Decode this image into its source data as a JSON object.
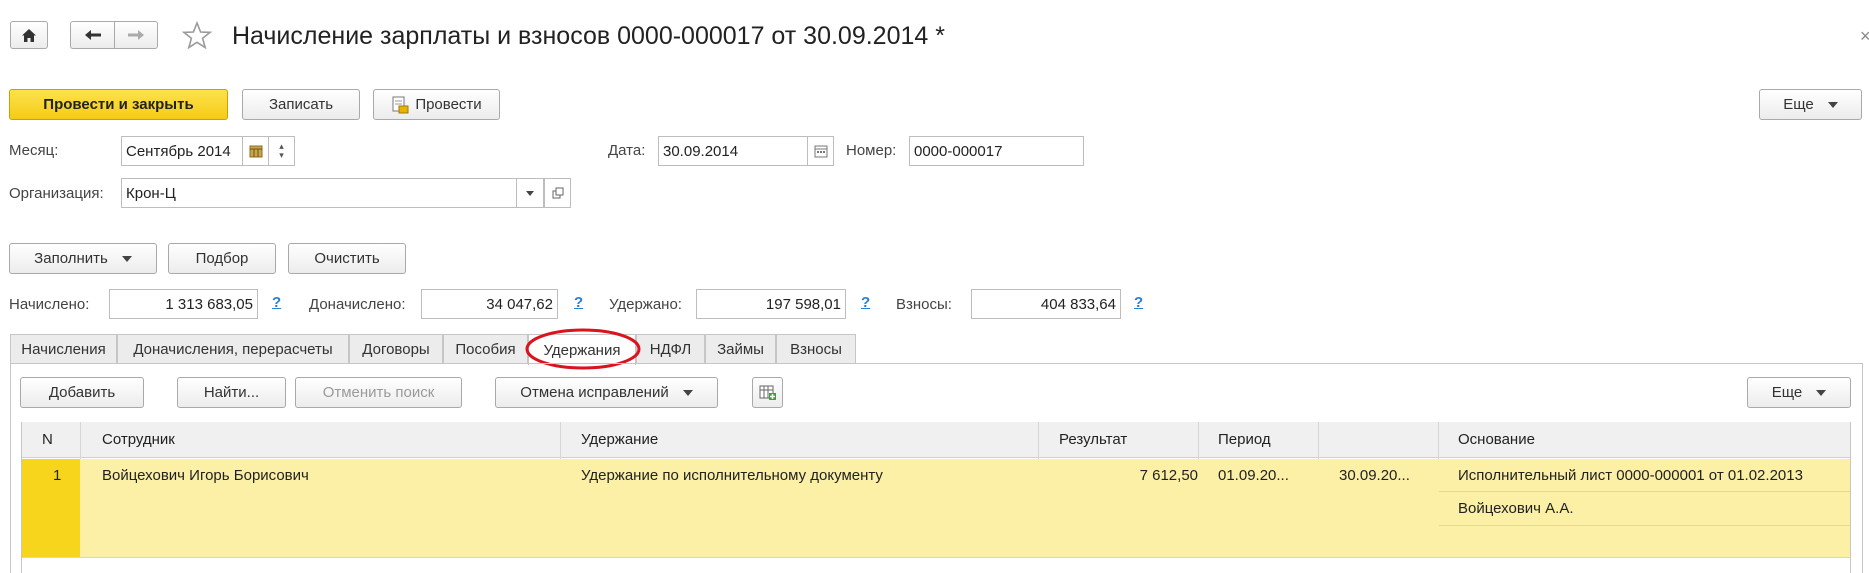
{
  "window": {
    "title": "Начисление зарплаты и взносов 0000-000017 от 30.09.2014 *"
  },
  "toolbar": {
    "post_close": "Провести и закрыть",
    "save": "Записать",
    "post": "Провести",
    "more": "Еще"
  },
  "form": {
    "month_label": "Месяц:",
    "month_value": "Сентябрь 2014",
    "date_label": "Дата:",
    "date_value": "30.09.2014",
    "number_label": "Номер:",
    "number_value": "0000-000017",
    "org_label": "Организация:",
    "org_value": "Крон-Ц"
  },
  "actions": {
    "fill": "Заполнить",
    "select": "Подбор",
    "clear": "Очистить"
  },
  "totals": {
    "accrued_label": "Начислено:",
    "accrued_value": "1 313 683,05",
    "extra_label": "Доначислено:",
    "extra_value": "34 047,62",
    "withheld_label": "Удержано:",
    "withheld_value": "197 598,01",
    "contrib_label": "Взносы:",
    "contrib_value": "404 833,64",
    "help": "?"
  },
  "tabs": [
    {
      "label": "Начисления"
    },
    {
      "label": "Доначисления, перерасчеты"
    },
    {
      "label": "Договоры"
    },
    {
      "label": "Пособия"
    },
    {
      "label": "Удержания",
      "active": true
    },
    {
      "label": "НДФЛ"
    },
    {
      "label": "Займы"
    },
    {
      "label": "Взносы"
    }
  ],
  "tab_toolbar": {
    "add": "Добавить",
    "find": "Найти...",
    "cancel_search": "Отменить поиск",
    "cancel_corrections": "Отмена исправлений",
    "more": "Еще"
  },
  "table": {
    "columns": [
      "N",
      "Сотрудник",
      "Удержание",
      "Результат",
      "Период",
      "",
      "Основание"
    ],
    "rows": [
      {
        "n": "1",
        "employee": "Войцехович Игорь Борисович",
        "deduction": "Удержание по исполнительному документу",
        "result": "7 612,50",
        "period_from": "01.09.20...",
        "period_to": "30.09.20...",
        "basis": "Исполнительный лист 0000-000001 от 01.02.2013",
        "basis_person": "Войцехович А.А."
      }
    ]
  },
  "colors": {
    "primary": "#f5cb16",
    "row_highlight": "#fbf0a6",
    "row_number": "#f7d51d",
    "annotation": "#d9141e",
    "link": "#2a7ed3"
  }
}
